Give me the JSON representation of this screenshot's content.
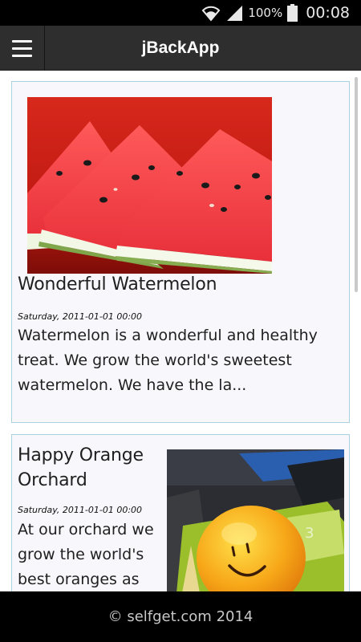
{
  "status_bar": {
    "battery_percent": "100%",
    "time": "00:08",
    "icons": [
      "wifi-icon",
      "signal-icon",
      "battery-icon"
    ]
  },
  "header": {
    "title": "jBackApp",
    "menu_icon": "hamburger-menu-icon"
  },
  "posts": [
    {
      "title": "Wonderful Watermelon",
      "date": "Saturday, 2011-01-01 00:00",
      "excerpt": "Watermelon is a wonderful and healthy treat. We grow the world's sweetest watermelon. We have the la...",
      "image": "watermelon-slices-image"
    },
    {
      "title": "Happy Orange Orchard",
      "date": "Saturday, 2011-01-01 00:00",
      "excerpt": "At our orchard we grow the world's best oranges as",
      "image": "smiling-orange-image"
    }
  ],
  "footer": {
    "copyright": "© selfget.com 2014"
  },
  "colors": {
    "header_bg": "#2e2e2e",
    "card_border": "#a9d3e2",
    "card_bg": "#f7f7fc"
  }
}
